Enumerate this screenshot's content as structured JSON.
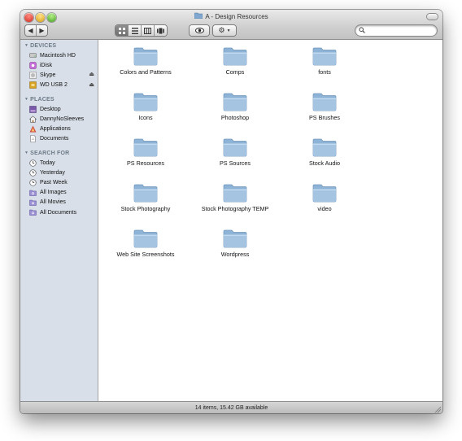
{
  "window": {
    "title": "A - Design Resources",
    "status_text": "14 items, 15.42 GB available"
  },
  "toolbar": {
    "back_icon": "chevron-left-icon",
    "forward_icon": "chevron-right-icon",
    "view_modes": [
      "icon-view",
      "list-view",
      "column-view",
      "coverflow-view"
    ],
    "active_view": "icon-view",
    "quicklook_icon": "eye-icon",
    "action_icon": "gear-icon",
    "search_placeholder": ""
  },
  "sidebar": {
    "devices_header": "DEVICES",
    "devices": [
      {
        "label": "Macintosh HD",
        "icon": "hard-drive-icon",
        "eject": false
      },
      {
        "label": "iDisk",
        "icon": "idisk-icon",
        "eject": false
      },
      {
        "label": "Skype",
        "icon": "disk-image-icon",
        "eject": true
      },
      {
        "label": "WD USB 2",
        "icon": "usb-drive-icon",
        "eject": true
      }
    ],
    "places_header": "PLACES",
    "places": [
      {
        "label": "Desktop",
        "icon": "desktop-icon"
      },
      {
        "label": "DannyNoSleeves",
        "icon": "home-icon"
      },
      {
        "label": "Applications",
        "icon": "applications-icon"
      },
      {
        "label": "Documents",
        "icon": "documents-icon"
      }
    ],
    "search_header": "SEARCH FOR",
    "searches": [
      {
        "label": "Today",
        "icon": "clock-icon"
      },
      {
        "label": "Yesterday",
        "icon": "clock-icon"
      },
      {
        "label": "Past Week",
        "icon": "clock-icon"
      },
      {
        "label": "All Images",
        "icon": "smart-folder-icon"
      },
      {
        "label": "All Movies",
        "icon": "smart-folder-icon"
      },
      {
        "label": "All Documents",
        "icon": "smart-folder-icon"
      }
    ]
  },
  "folders": [
    "Colors and Patterns",
    "Comps",
    "fonts",
    "Icons",
    "Photoshop",
    "PS Brushes",
    "PS Resources",
    "PS Sources",
    "Stock Audio",
    "Stock Photography",
    "Stock Photography TEMP",
    "video",
    "Web Site Screenshots",
    "Wordpress"
  ],
  "colors": {
    "sidebar_bg": "#d8dfe8",
    "sidebar_header": "#6d7a88",
    "folder_blue": "#8fb4d6"
  }
}
